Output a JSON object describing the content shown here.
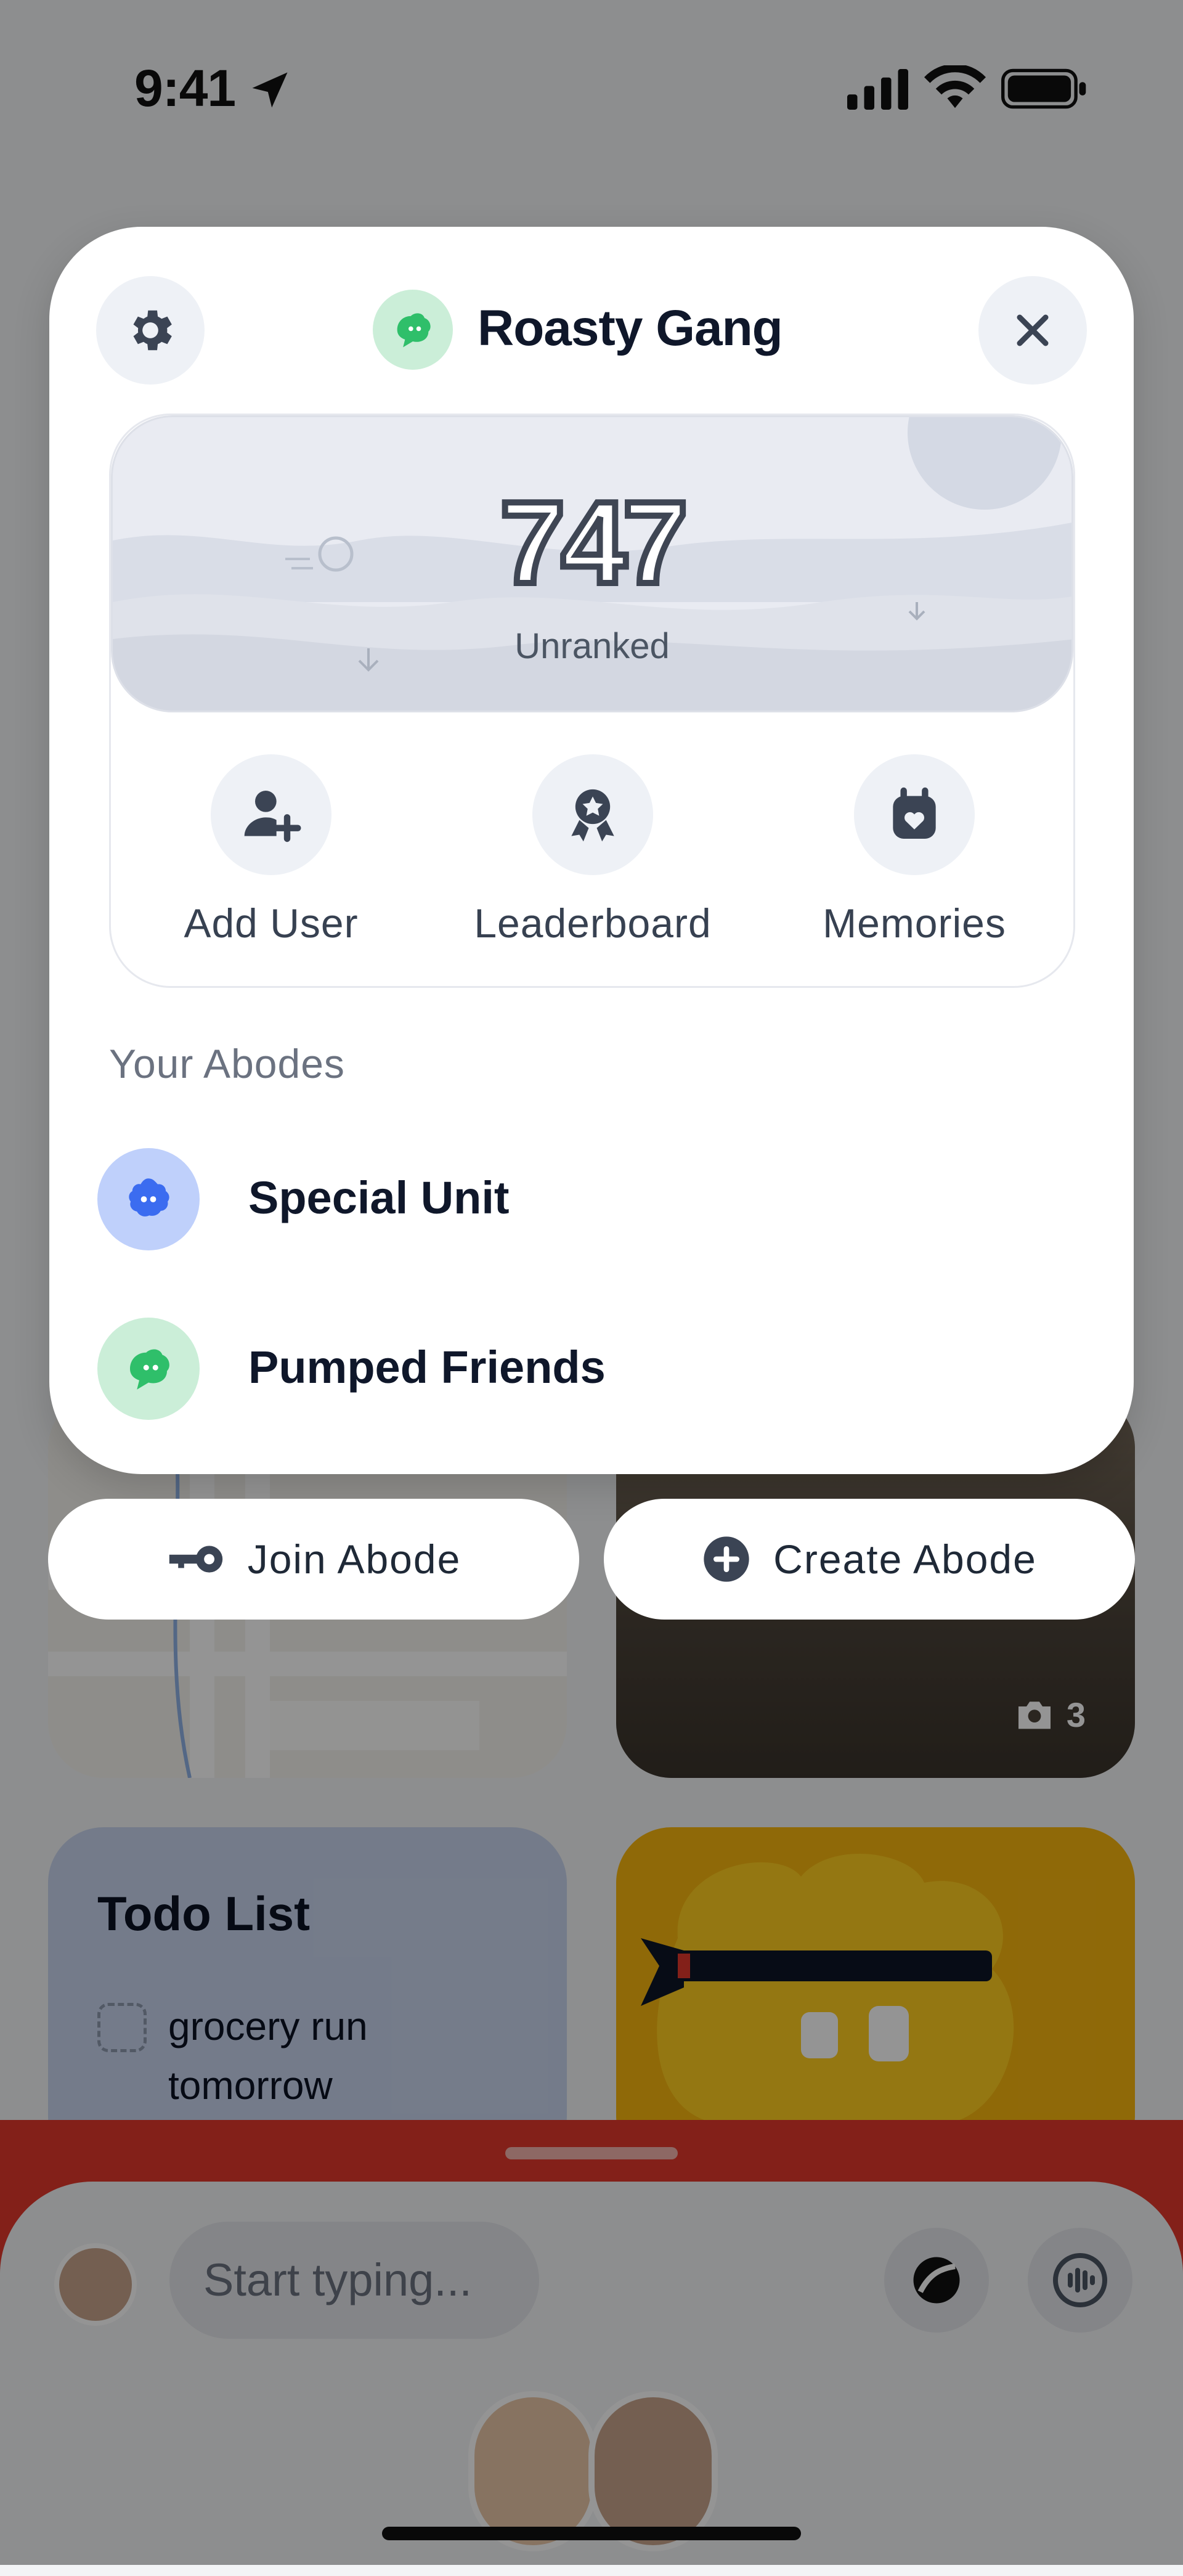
{
  "status_bar": {
    "time": "9:41"
  },
  "modal": {
    "title": "Roasty Gang",
    "score": "747",
    "rank": "Unranked",
    "actions": [
      {
        "label": "Add User",
        "icon": "add-user-icon"
      },
      {
        "label": "Leaderboard",
        "icon": "award-icon"
      },
      {
        "label": "Memories",
        "icon": "memories-icon"
      }
    ],
    "abodes_heading": "Your Abodes",
    "abodes": [
      {
        "name": "Special Unit",
        "color": "#bfd0fb",
        "accent": "#3b6cf0"
      },
      {
        "name": "Pumped Friends",
        "color": "#cbeed8",
        "accent": "#2fbf6a"
      }
    ]
  },
  "buttons": {
    "join": "Join Abode",
    "create": "Create Abode"
  },
  "background": {
    "photo_count": "3",
    "todo_title": "Todo List",
    "todo_item": "grocery run tomorrow",
    "composer_placeholder": "Start typing..."
  },
  "colors": {
    "red_bar": "#e2372c",
    "sticker": "#f7b50f",
    "todo_card": "#c9d5ee"
  }
}
